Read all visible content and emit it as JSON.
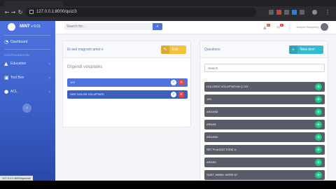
{
  "browser": {
    "url": "127.0.0.1:8000/quiz/3",
    "status_url": "127.0.0.1:8000/quiz/##"
  },
  "sidebar": {
    "brand": "MINT",
    "version": "v 0.01",
    "heading": "CONFIGURATION",
    "toggle_icon": "‹",
    "items": [
      {
        "label": "Dashboard",
        "icon": "gauge-icon"
      },
      {
        "label": "Education",
        "icon": "graduation-icon"
      },
      {
        "label": "Tool Box",
        "icon": "toolbox-icon"
      },
      {
        "label": "ACL",
        "icon": "users-icon"
      }
    ]
  },
  "topbar": {
    "search_placeholder": "Search for...",
    "alerts_badge": "3+",
    "messages_badge": "7",
    "user_name": "Joseph Humphrey"
  },
  "left_card": {
    "title": "Et sed magnam amet e",
    "edit_label": "Edit",
    "subtitle": "Eligendi voluptates",
    "options": [
      {
        "label": "123",
        "check_icon": "✓",
        "delete_icon": "×"
      },
      {
        "label": "SINT DOLOR VOLUPTATE",
        "check_icon": "✓",
        "delete_icon": "×"
      }
    ]
  },
  "right_card": {
    "title": "Questions",
    "new_label": "New item",
    "search_placeholder": "Search",
    "questions": [
      "DOLORES VOLUPTATUM Q 123",
      "123",
      "ASDASD",
      "ASDAS",
      "ASDASD",
      "SET PLACEAT ESSE U",
      "ASDAS",
      "SUNT, MINIM, MORE AT"
    ]
  },
  "colors": {
    "primary": "#4e73df",
    "warning": "#f6c23e",
    "info": "#36b9cc",
    "success": "#1cc88a",
    "danger": "#e74a3b",
    "dark": "#5a5c69"
  }
}
